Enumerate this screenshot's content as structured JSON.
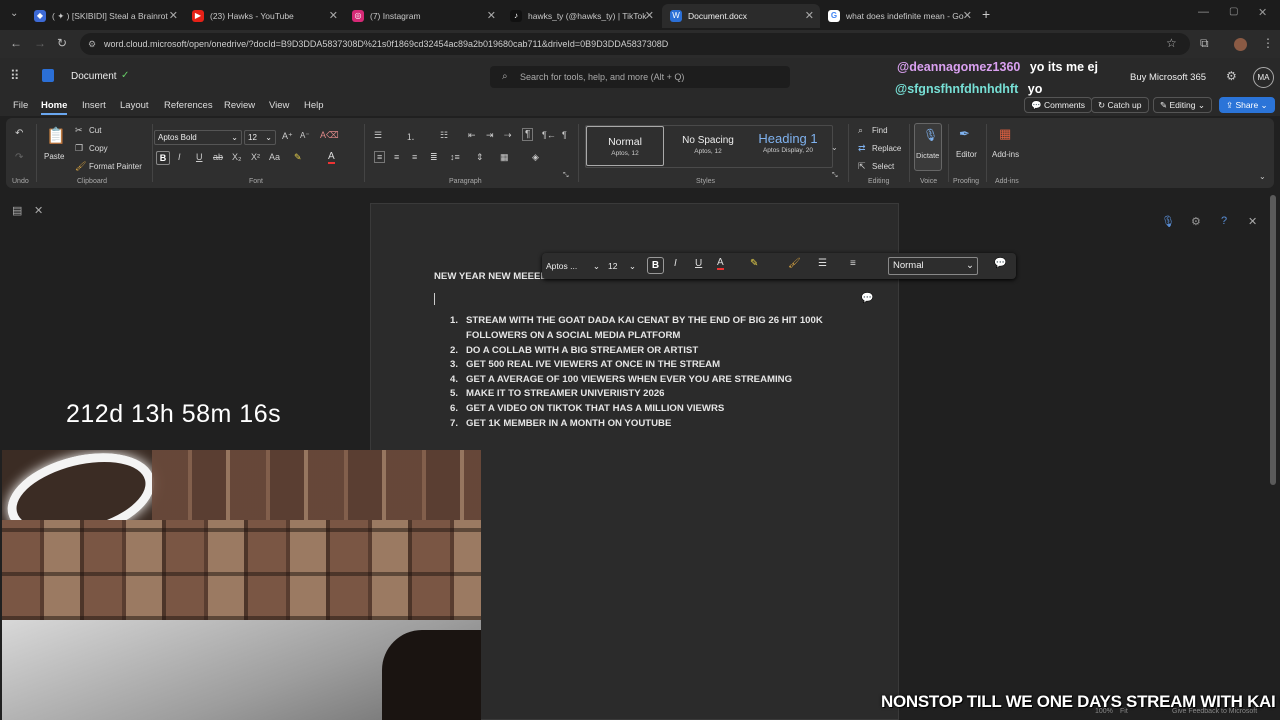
{
  "tabs": [
    {
      "label": "( ✦ ) [SKIBIDI] Steal a Brainrot",
      "color": "#3d6ad6",
      "icon": "roblox-icon"
    },
    {
      "label": "(23) Hawks - YouTube",
      "color": "#e62117",
      "icon": "youtube-icon"
    },
    {
      "label": "(7) Instagram",
      "color": "#d62976",
      "icon": "instagram-icon"
    },
    {
      "label": "hawks_ty (@hawks_ty) | TikTok",
      "color": "#111111",
      "icon": "tiktok-icon"
    },
    {
      "label": "Document.docx",
      "color": "#2b6fd6",
      "icon": "word-icon"
    },
    {
      "label": "what does indefinite mean - Go",
      "color": "#ffffff",
      "icon": "google-icon"
    }
  ],
  "address": {
    "url": "word.cloud.microsoft/open/onedrive/?docId=B9D3DDA5837308D%21s0f1869cd32454ac89a2b019680cab711&driveId=0B9D3DDA5837308D"
  },
  "word": {
    "doc_title": "Document",
    "search_placeholder": "Search for tools, help, and more (Alt + Q)",
    "buy_label": "Buy Microsoft 365",
    "avatar": "MA"
  },
  "menu": {
    "items": [
      "File",
      "Home",
      "Insert",
      "Layout",
      "References",
      "Review",
      "View",
      "Help"
    ],
    "comments": "Comments",
    "catchup": "Catch up",
    "editing": "Editing",
    "share": "Share"
  },
  "ribbon": {
    "undo": "Undo",
    "paste": "Paste",
    "cut": "Cut",
    "copy": "Copy",
    "format_painter": "Format Painter",
    "clipboard": "Clipboard",
    "font_name": "Aptos Bold",
    "font_size": "12",
    "font": "Font",
    "paragraph": "Paragraph",
    "styles": "Styles",
    "style_normal": "Normal",
    "style_normal_sub": "Aptos, 12",
    "style_nospacing": "No Spacing",
    "style_nospacing_sub": "Aptos, 12",
    "style_heading": "Heading 1",
    "style_heading_sub": "Aptos Display, 20",
    "find": "Find",
    "replace": "Replace",
    "select": "Select",
    "editing_group": "Editing",
    "dictate": "Dictate",
    "voice": "Voice",
    "editor": "Editor",
    "proofing": "Proofing",
    "addins": "Add-ins",
    "addins_group": "Add-ins"
  },
  "document": {
    "heading": "NEW YEAR NEW MEEEEE",
    "goals": [
      "STREAM WITH THE GOAT DADA KAI CENAT BY THE END OF BIG 26 HIT 100K",
      "FOLLOWERS ON A SOCIAL MEDIA PLATFORM",
      "DO A COLLAB WITH A BIG STREAMER OR ARTIST",
      "GET 500 REAL IVE VIEWERS AT ONCE IN THE STREAM",
      "GET A AVERAGE OF 100 VIEWERS WHEN EVER YOU ARE STREAMING",
      "MAKE IT TO STREAMER UNIVERIISTY 2026",
      "GET A VIDEO ON TIKTOK THAT HAS A MILLION VIEWRS",
      "GET 1K MEMBER IN A MONTH ON YOUTUBE"
    ],
    "numbers": [
      "1.",
      "2.",
      "3.",
      "4.",
      "5.",
      "6.",
      "7."
    ]
  },
  "minitoolbar": {
    "font": "Aptos ...",
    "size": "12",
    "style": "Normal"
  },
  "overlay": {
    "user1": "@deannagomez1360",
    "msg1": "yo its me ej",
    "user2": "@sfgnsfhnfdhnhdhft",
    "msg2": "yo",
    "timer": "212d 13h 58m 16s",
    "banner": "NONSTOP TILL WE ONE DAYS STREAM WITH KAI CENAT"
  },
  "statusbar": {
    "zoom": "100%",
    "fit": "Fit",
    "feedback": "Give Feedback to Microsoft"
  }
}
